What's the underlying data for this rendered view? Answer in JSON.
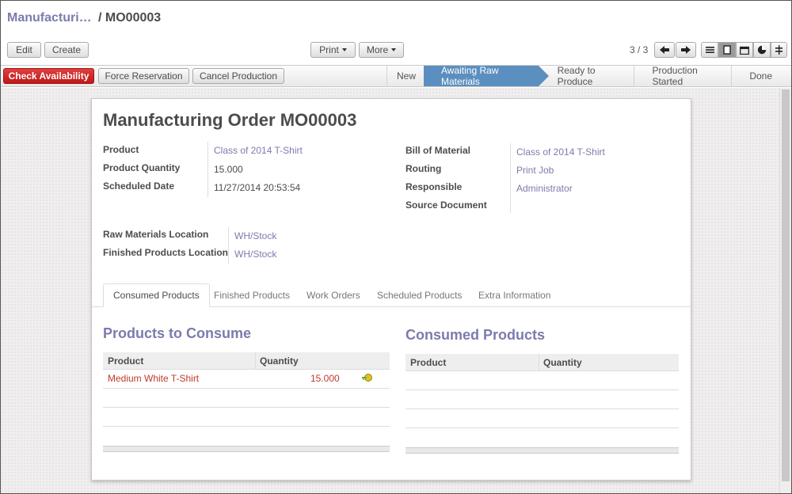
{
  "breadcrumb": {
    "parent": "Manufacturi…",
    "current": "/ MO00003"
  },
  "toolbar": {
    "edit_label": "Edit",
    "create_label": "Create",
    "print_label": "Print",
    "more_label": "More",
    "pager": "3 / 3"
  },
  "actions": {
    "check_availability": "Check Availability",
    "force_reservation": "Force Reservation",
    "cancel_production": "Cancel Production"
  },
  "stages": [
    "New",
    "Awaiting Raw Materials",
    "Ready to Produce",
    "Production Started",
    "Done"
  ],
  "active_stage": "Awaiting Raw Materials",
  "form": {
    "title_prefix": "Manufacturing Order",
    "title_ref": "MO00003",
    "left": [
      {
        "label": "Product",
        "value": "Class of 2014 T-Shirt"
      },
      {
        "label": "Product Quantity",
        "value": "15.000"
      },
      {
        "label": "Scheduled Date",
        "value": "11/27/2014 20:53:54"
      }
    ],
    "right": [
      {
        "label": "Bill of Material",
        "value": "Class of 2014 T-Shirt"
      },
      {
        "label": "Routing",
        "value": "Print Job"
      },
      {
        "label": "Responsible",
        "value": "Administrator"
      },
      {
        "label": "Source Document",
        "value": ""
      }
    ],
    "locations": [
      {
        "label": "Raw Materials Location",
        "value": "WH/Stock"
      },
      {
        "label": "Finished Products Location",
        "value": "WH/Stock"
      }
    ]
  },
  "tabs": [
    "Consumed Products",
    "Finished Products",
    "Work Orders",
    "Scheduled Products",
    "Extra Information"
  ],
  "to_consume": {
    "title": "Products to Consume",
    "columns": [
      "Product",
      "Quantity"
    ],
    "rows": [
      {
        "product": "Medium White T-Shirt",
        "quantity": "15.000"
      }
    ]
  },
  "consumed": {
    "title": "Consumed Products",
    "columns": [
      "Product",
      "Quantity"
    ],
    "rows": []
  },
  "colors": {
    "link": "#7c7bad",
    "danger": "#c01818",
    "stage_active": "#5b8fbf",
    "row_alert": "#c0392b"
  }
}
